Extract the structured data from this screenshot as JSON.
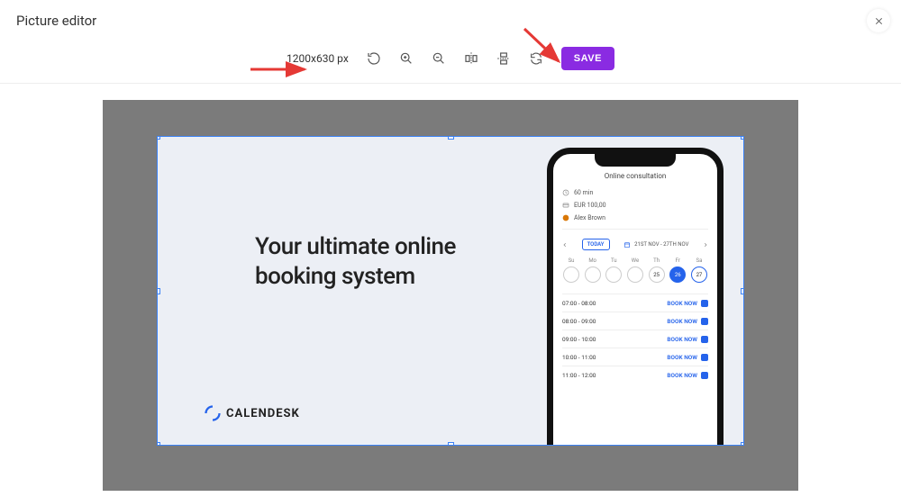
{
  "window": {
    "title": "Picture editor"
  },
  "toolbar": {
    "dimensions": "1200x630 px",
    "save_label": "SAVE"
  },
  "promo": {
    "headline": "Your ultimate online booking system",
    "brand": "CALENDESK"
  },
  "phone": {
    "title": "Online consultation",
    "duration": "60 min",
    "price": "EUR 100,00",
    "user": "Alex Brown",
    "today_label": "TODAY",
    "date_range": "21ST NOV - 27TH NOV",
    "days": [
      {
        "name": "Su",
        "num": "",
        "sel": false
      },
      {
        "name": "Mo",
        "num": "",
        "sel": false
      },
      {
        "name": "Tu",
        "num": "",
        "sel": false
      },
      {
        "name": "We",
        "num": "",
        "sel": false
      },
      {
        "name": "Th",
        "num": "25",
        "sel": false
      },
      {
        "name": "Fr",
        "num": "26",
        "sel": true
      },
      {
        "name": "Sa",
        "num": "27",
        "sel": false
      }
    ],
    "book_now": "BOOK NOW",
    "slots": [
      "07:00 - 08:00",
      "08:00 - 09:00",
      "09:00 - 10:00",
      "10:00 - 11:00",
      "11:00 - 12:00"
    ]
  }
}
